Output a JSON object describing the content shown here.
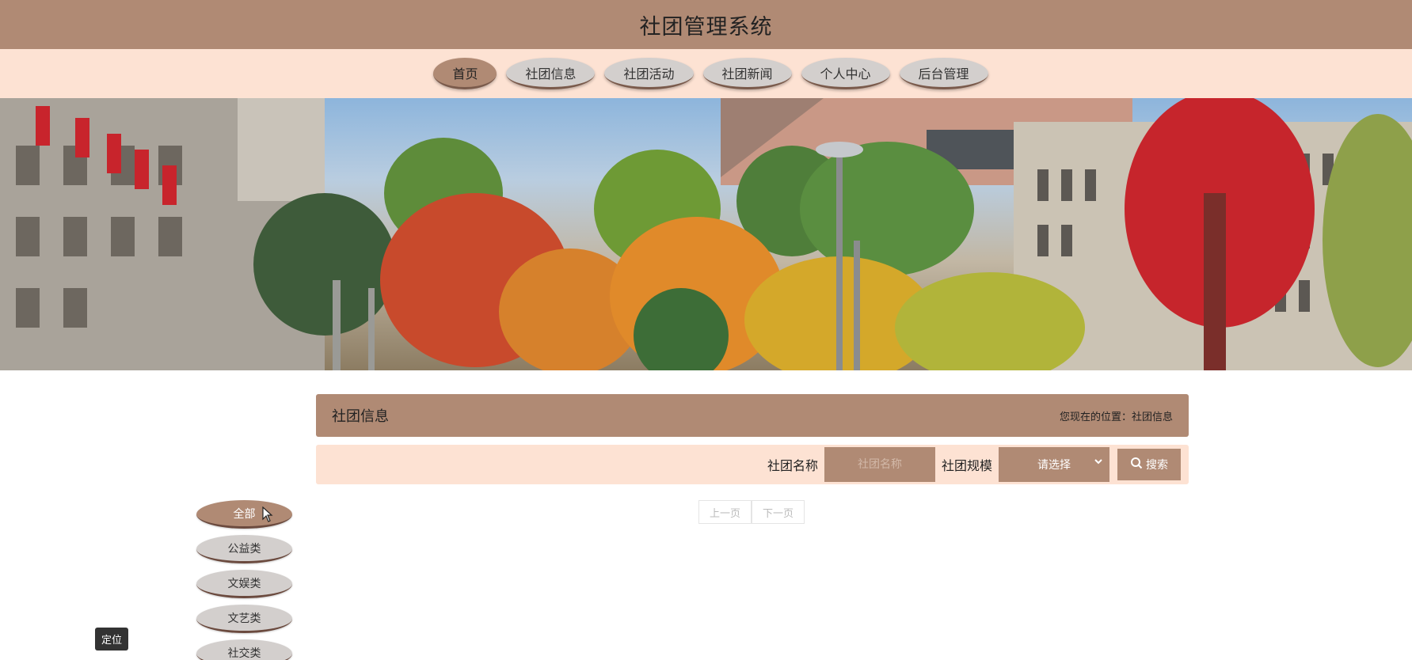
{
  "header": {
    "title": "社团管理系统"
  },
  "nav": {
    "items": [
      {
        "label": "首页",
        "active": true
      },
      {
        "label": "社团信息",
        "active": false
      },
      {
        "label": "社团活动",
        "active": false
      },
      {
        "label": "社团新闻",
        "active": false
      },
      {
        "label": "个人中心",
        "active": false
      },
      {
        "label": "后台管理",
        "active": false
      }
    ]
  },
  "banner": {
    "slides": 3,
    "active_slide": 1
  },
  "section": {
    "title": "社团信息",
    "breadcrumb": "您现在的位置：社团信息"
  },
  "search": {
    "name_label": "社团名称",
    "name_placeholder": "社团名称",
    "scale_label": "社团规模",
    "scale_value": "请选择",
    "button_label": "搜索"
  },
  "pagination": {
    "prev": "上一页",
    "next": "下一页"
  },
  "categories": [
    {
      "label": "全部",
      "active": true
    },
    {
      "label": "公益类",
      "active": false
    },
    {
      "label": "文娱类",
      "active": false
    },
    {
      "label": "文艺类",
      "active": false
    },
    {
      "label": "社交类",
      "active": false
    }
  ],
  "locate": {
    "label": "定位"
  },
  "colors": {
    "primary": "#b08a74",
    "light": "#fde2d3",
    "pill": "#d3cfcd"
  },
  "icons": {
    "search": "search-icon",
    "select": "chevron-down-icon",
    "cursor": "cursor-arrow-icon"
  }
}
